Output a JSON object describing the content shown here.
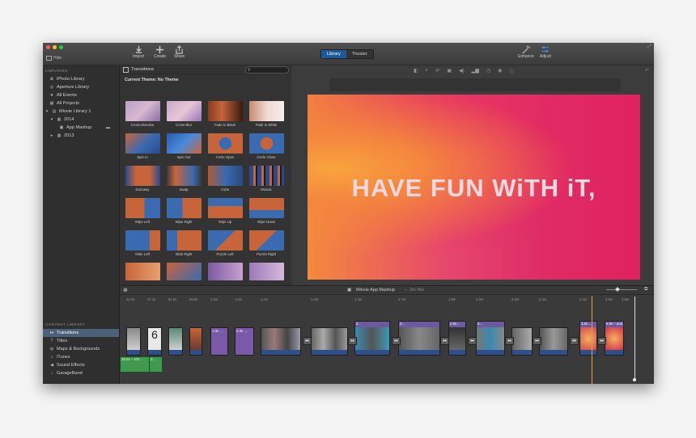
{
  "toolbar": {
    "hide_label": "Hide",
    "import_label": "Import",
    "create_label": "Create",
    "share_label": "Share",
    "tab_library": "Library",
    "tab_theater": "Theater",
    "enhance_label": "Enhance",
    "adjust_label": "Adjust"
  },
  "sidebar": {
    "libraries_label": "LIBRARIES",
    "libraries": [
      "iPhoto Library",
      "Aperture Library",
      "All Events",
      "All Projects",
      "iMovie Library 1",
      "2014",
      "App Mashup",
      "2013"
    ],
    "content_label": "CONTENT LIBRARY",
    "content": [
      "Transitions",
      "Titles",
      "Maps & Backgrounds",
      "iTunes",
      "Sound Effects",
      "GarageBand"
    ]
  },
  "browser": {
    "title": "Transitions",
    "theme": "Current Theme: No Theme",
    "transitions": [
      "Cross Dissolve",
      "Cross Blur",
      "Fade to Black",
      "Fade to White",
      "Spin In",
      "Spin Out",
      "Circle Open",
      "Circle Close",
      "Doorway",
      "Swap",
      "Cube",
      "Mosaic",
      "Wipe Left",
      "Wipe Right",
      "Wipe Up",
      "Wipe Down",
      "Slide Left",
      "Slide Right",
      "Puzzle Left",
      "Puzzle Right"
    ]
  },
  "viewer": {
    "caption": "HAVE FUN WiTH iT,"
  },
  "timeline": {
    "project_title": "iMovie App Mashup",
    "duration": "2m 46s",
    "ruler": [
      "42.1s",
      "47.1s",
      "51.5s",
      "56.0s",
      "1.0m",
      "1.0m",
      "1.1m",
      "1.3m",
      "1.4m",
      "1.7m",
      "1.9m",
      "2.0m",
      "2.2m",
      "2.3m",
      "2.4m",
      "2.5m",
      "2.6m"
    ],
    "clip_labels": [
      "1.3s …",
      "4.3s …",
      "2…",
      "3…",
      "2.5s…",
      "4…",
      "3.5s…",
      "5.9s – and…"
    ],
    "audio_labels": [
      "20.6s – VO…",
      "3…"
    ]
  },
  "colors": {
    "accent": "#1d5a9a",
    "selection": "#4d6079",
    "clip_title": "#6b5a9f",
    "clip_audio_strip": "#2e4f8c",
    "audio_clip": "#3f9a4e",
    "playhead": "#f29a3a"
  }
}
